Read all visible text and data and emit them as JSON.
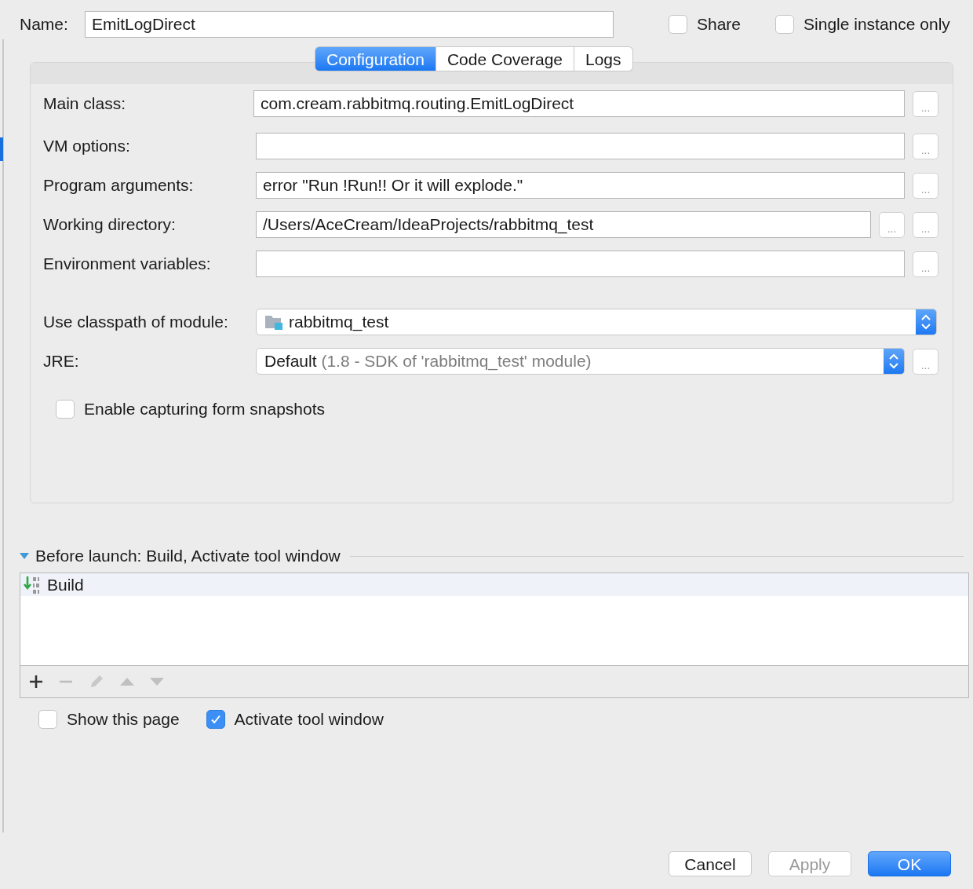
{
  "name_field": {
    "label": "Name:",
    "value": "EmitLogDirect"
  },
  "options": [
    {
      "label": "Share",
      "checked": false
    },
    {
      "label": "Single instance only",
      "checked": false
    }
  ],
  "tabs": [
    {
      "label": "Configuration",
      "selected": true
    },
    {
      "label": "Code Coverage",
      "selected": false
    },
    {
      "label": "Logs",
      "selected": false
    }
  ],
  "fields": [
    {
      "kind": "text",
      "label": "Main class:",
      "value": "com.cream.rabbitmq.routing.EmitLogDirect",
      "buttons": [
        "..."
      ]
    },
    {
      "kind": "text",
      "label": "VM options:",
      "buttons": [
        "..."
      ]
    },
    {
      "kind": "text",
      "label": "Program arguments:",
      "value": "error \"Run !Run!! Or it will explode.\"",
      "buttons": [
        "..."
      ]
    },
    {
      "kind": "text",
      "label": "Working directory:",
      "value": "/Users/AceCream/IdeaProjects/rabbitmq_test",
      "buttons": [
        "...",
        "..."
      ]
    },
    {
      "kind": "text",
      "label": "Environment variables:",
      "buttons": [
        "..."
      ]
    },
    {
      "kind": "module",
      "label": "Use classpath of module:",
      "value": "rabbitmq_test"
    },
    {
      "kind": "jre",
      "label": "JRE:",
      "value": "Default",
      "hint": "(1.8 - SDK of 'rabbitmq_test' module)",
      "buttons": [
        "..."
      ]
    }
  ],
  "snapshots": {
    "label": "Enable capturing form snapshots",
    "checked": false
  },
  "before_launch": {
    "title": "Before launch: Build, Activate tool window",
    "expanded": true,
    "tasks": [
      {
        "label": "Build",
        "selected": true
      }
    ]
  },
  "footer_options": [
    {
      "label": "Show this page",
      "checked": false
    },
    {
      "label": "Activate tool window",
      "checked": true
    }
  ],
  "buttons": [
    {
      "label": "Cancel",
      "kind": "normal"
    },
    {
      "label": "Apply",
      "kind": "disabled"
    },
    {
      "label": "OK",
      "kind": "default"
    }
  ]
}
